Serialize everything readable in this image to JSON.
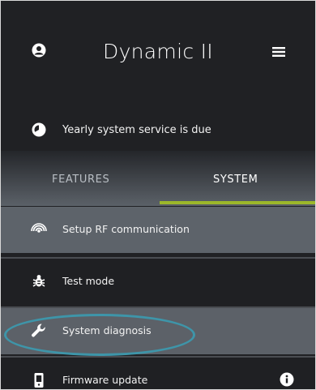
{
  "header": {
    "title": "Dynamic II",
    "user_icon": "user-circle-icon",
    "menu_icon": "hamburger-menu-icon"
  },
  "notice": {
    "icon": "service-clock-icon",
    "text": "Yearly system service is due"
  },
  "tabs": [
    {
      "label": "FEATURES",
      "active": false
    },
    {
      "label": "SYSTEM",
      "active": true
    }
  ],
  "accent_color": "#9cb72a",
  "highlight_color": "#3e95a9",
  "menu": {
    "items": [
      {
        "label": "Setup RF communication",
        "icon": "rf-signal-icon"
      },
      {
        "label": "Test mode",
        "icon": "bug-icon"
      },
      {
        "label": "System diagnosis",
        "icon": "wrench-icon"
      },
      {
        "label": "Firmware update",
        "icon": "device-icon",
        "trailing_icon": "info-icon"
      }
    ]
  }
}
